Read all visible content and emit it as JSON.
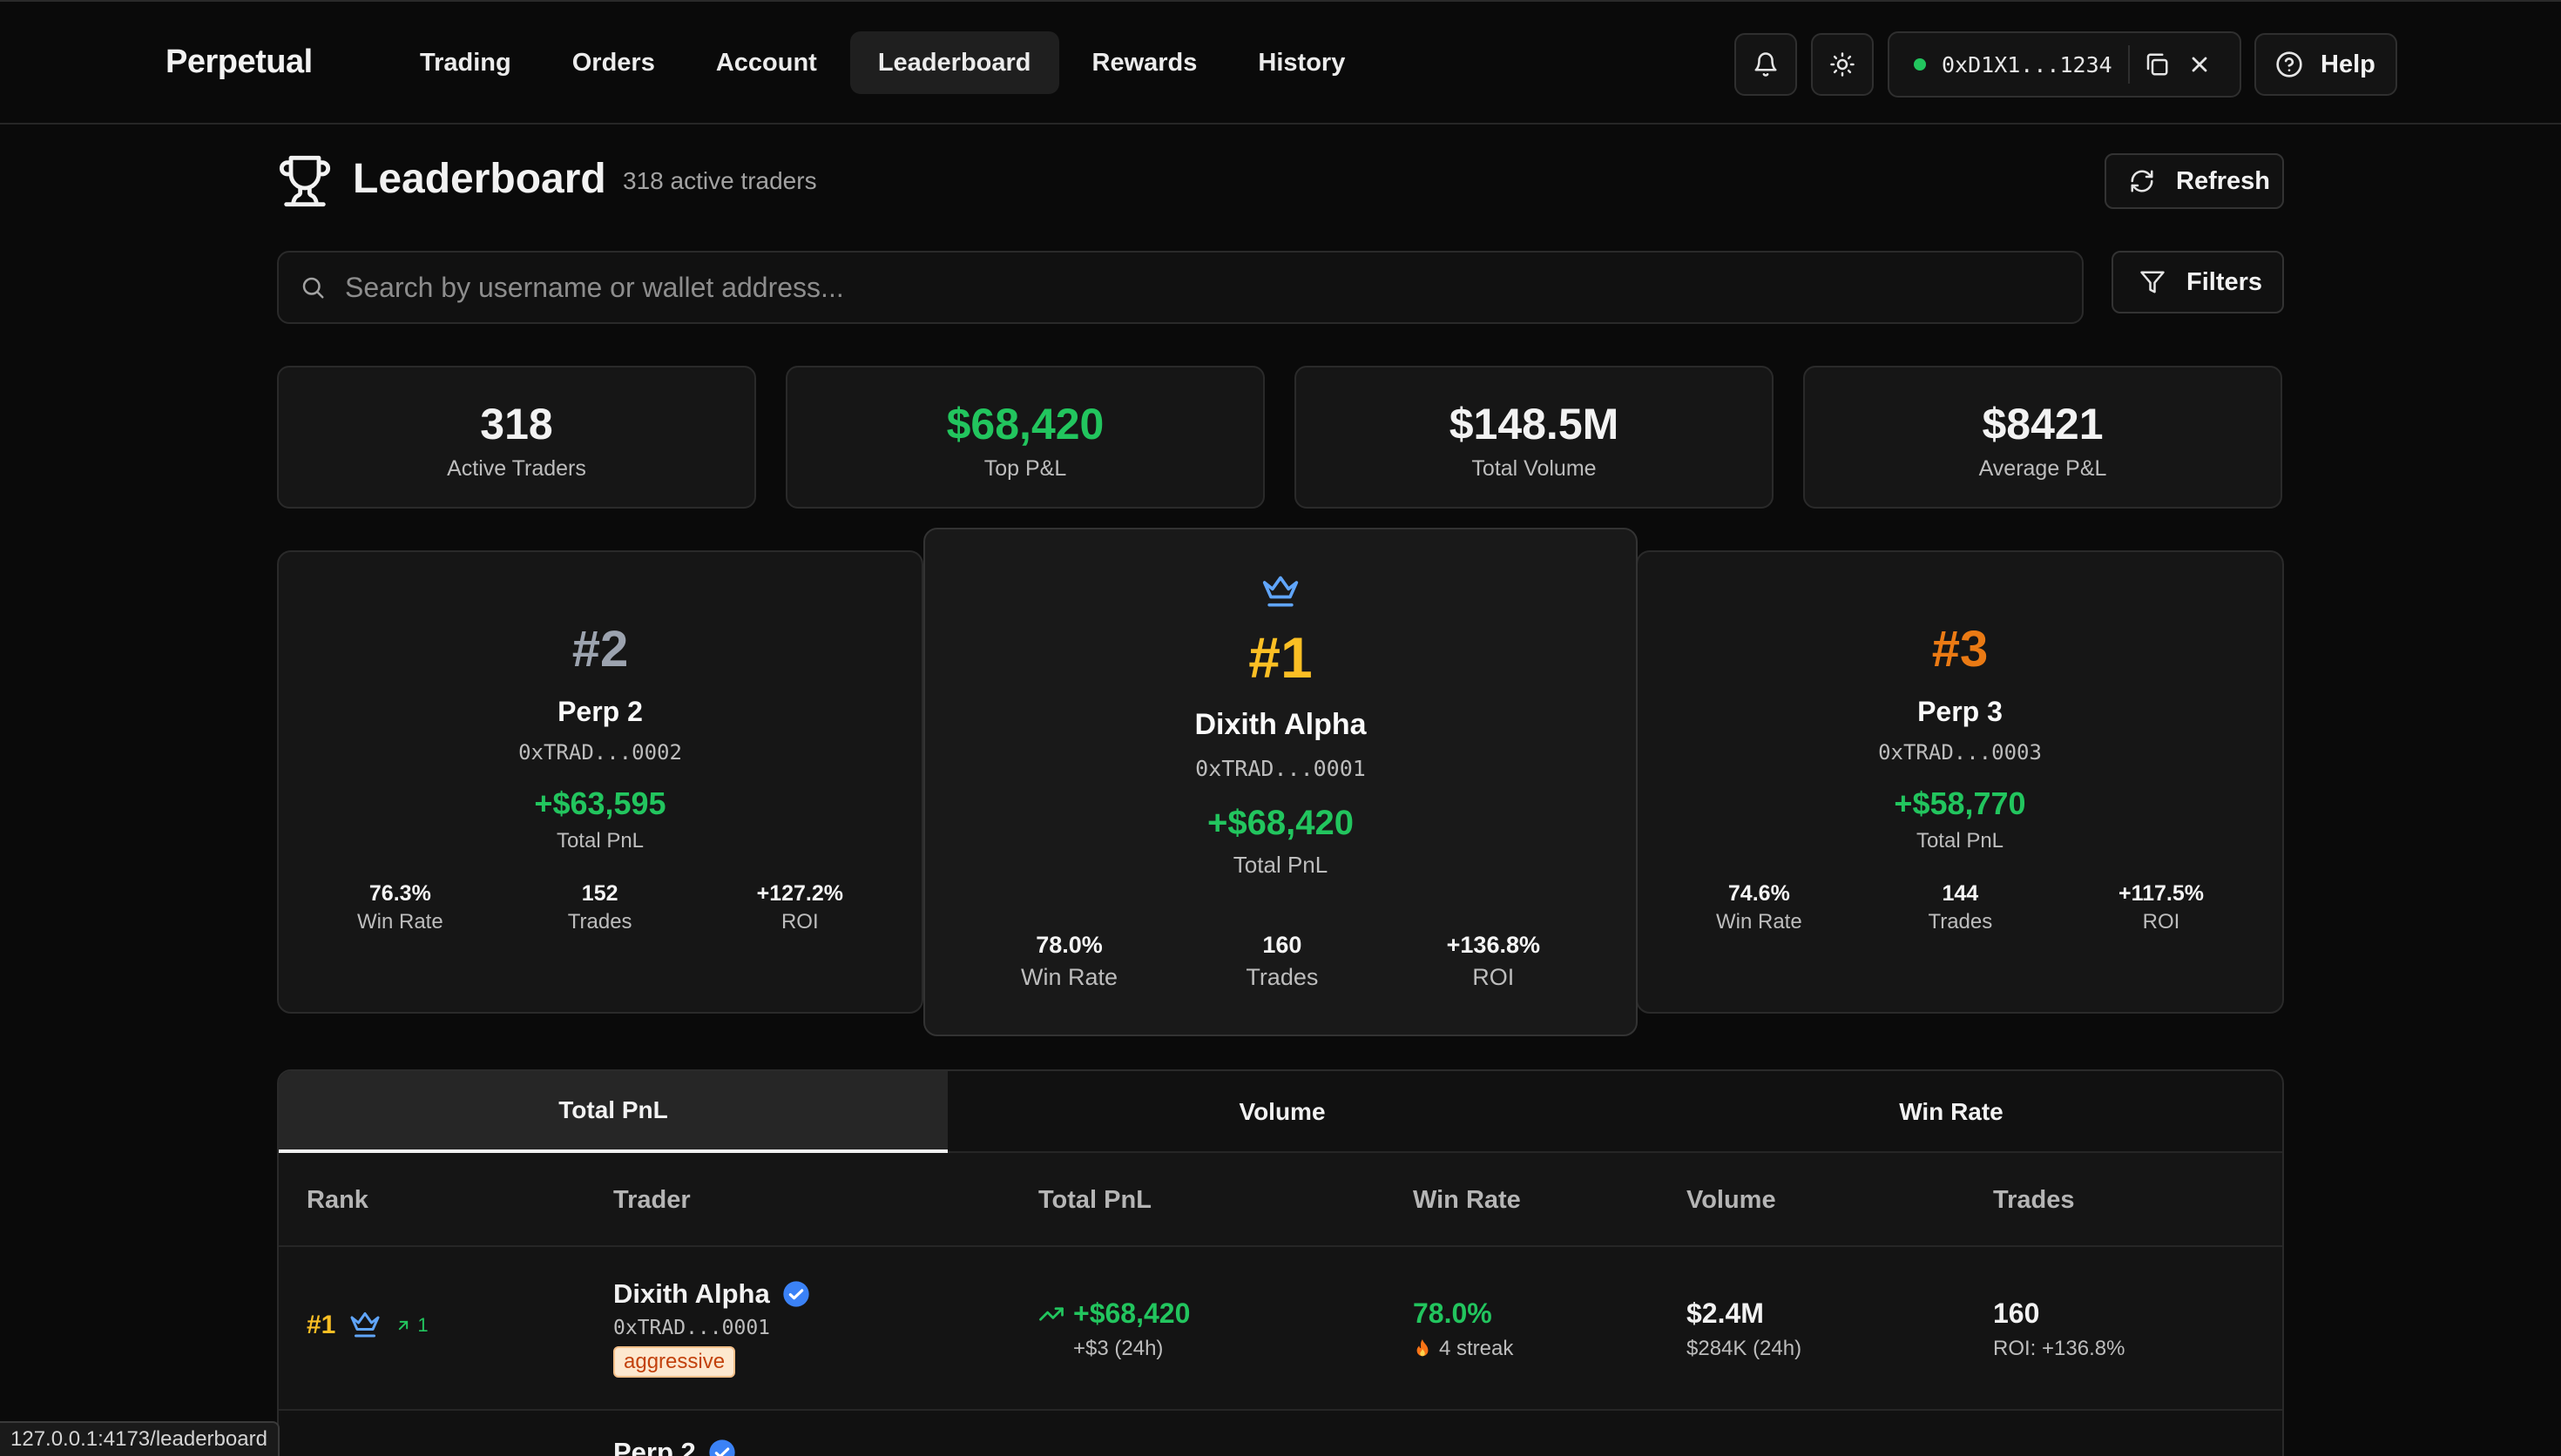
{
  "app": {
    "brand": "Perpetual"
  },
  "nav": {
    "items": [
      "Trading",
      "Orders",
      "Account",
      "Leaderboard",
      "Rewards",
      "History"
    ],
    "active": "Leaderboard"
  },
  "wallet": {
    "address": "0xD1X1...1234",
    "status_color": "#22c55e"
  },
  "help": {
    "label": "Help"
  },
  "header": {
    "title": "Leaderboard",
    "subtitle": "318 active traders",
    "refresh_label": "Refresh"
  },
  "search": {
    "placeholder": "Search by username or wallet address...",
    "value": "",
    "filters_label": "Filters"
  },
  "stats": [
    {
      "value": "318",
      "label": "Active Traders",
      "color": "#f2f2f2"
    },
    {
      "value": "$68,420",
      "label": "Top P&L",
      "color": "#22c55e"
    },
    {
      "value": "$148.5M",
      "label": "Total Volume",
      "color": "#f2f2f2"
    },
    {
      "value": "$8421",
      "label": "Average P&L",
      "color": "#f2f2f2"
    }
  ],
  "podium": {
    "second": {
      "rank": "#2",
      "name": "Perp 2",
      "address": "0xTRAD...0002",
      "pnl": "+$63,595",
      "pnl_label": "Total PnL",
      "win_rate": "76.3%",
      "win_rate_label": "Win Rate",
      "trades": "152",
      "trades_label": "Trades",
      "roi": "+127.2%",
      "roi_label": "ROI",
      "rank_color": "#9ca3af"
    },
    "first": {
      "rank": "#1",
      "name": "Dixith Alpha",
      "address": "0xTRAD...0001",
      "pnl": "+$68,420",
      "pnl_label": "Total PnL",
      "win_rate": "78.0%",
      "win_rate_label": "Win Rate",
      "trades": "160",
      "trades_label": "Trades",
      "roi": "+136.8%",
      "roi_label": "ROI",
      "rank_color": "#fbbf24",
      "icon": "crown-icon"
    },
    "third": {
      "rank": "#3",
      "name": "Perp 3",
      "address": "0xTRAD...0003",
      "pnl": "+$58,770",
      "pnl_label": "Total PnL",
      "win_rate": "74.6%",
      "win_rate_label": "Win Rate",
      "trades": "144",
      "trades_label": "Trades",
      "roi": "+117.5%",
      "roi_label": "ROI",
      "rank_color": "#ea7a14"
    }
  },
  "tabs": {
    "items": [
      "Total PnL",
      "Volume",
      "Win Rate"
    ],
    "active": "Total PnL"
  },
  "table": {
    "columns": [
      "Rank",
      "Trader",
      "Total PnL",
      "Win Rate",
      "Volume",
      "Trades"
    ],
    "rows": [
      {
        "rank": "#1",
        "rank_change": "1",
        "name": "Dixith Alpha",
        "address": "0xTRAD...0001",
        "tag": "aggressive",
        "pnl": "+$68,420",
        "pnl_24h": "+$3 (24h)",
        "win_rate": "78.0%",
        "streak": "4 streak",
        "volume": "$2.4M",
        "volume_24h": "$284K (24h)",
        "trades": "160",
        "roi": "ROI: +136.8%"
      }
    ],
    "partial_row_name": "Perp 2"
  },
  "status_bar": {
    "url": "127.0.0.1:4173/leaderboard"
  }
}
